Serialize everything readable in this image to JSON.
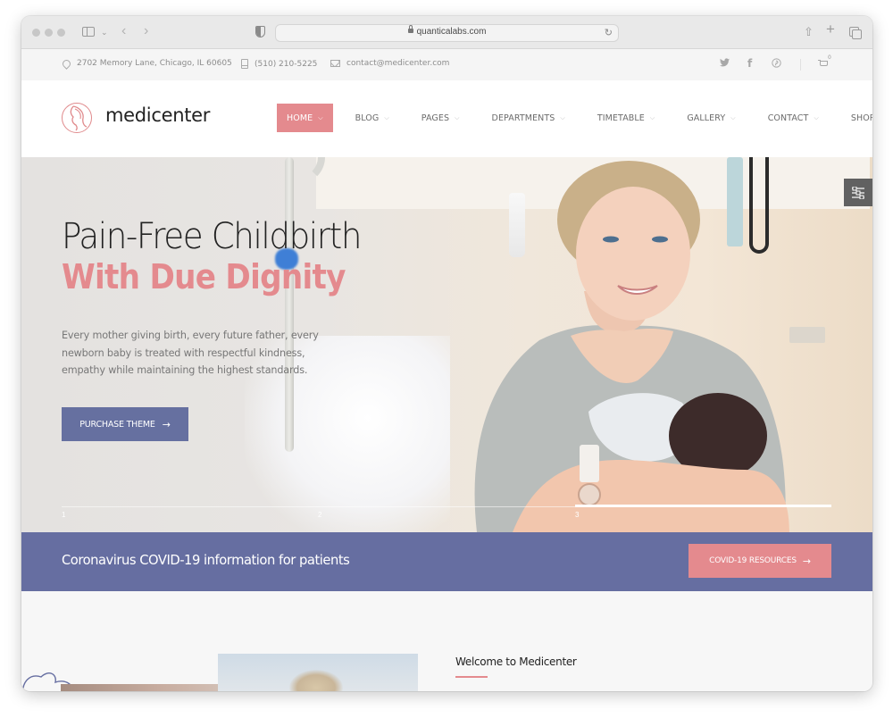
{
  "browser": {
    "url": "quanticalabs.com",
    "icons": [
      "sidebar-icon",
      "chevron-down-icon",
      "back-icon",
      "forward-icon",
      "privacy-shield-icon",
      "lock-icon",
      "reload-icon",
      "share-icon",
      "new-tab-icon",
      "tab-overview-icon"
    ]
  },
  "topbar": {
    "address": "2702 Memory Lane, Chicago, IL 60605",
    "phone": "(510) 210-5225",
    "email": "contact@medicenter.com",
    "social": [
      "twitter",
      "facebook",
      "pinterest"
    ],
    "social_glyphs": [
      "𝕥",
      "f",
      "℗"
    ],
    "cart_count": "0"
  },
  "header": {
    "logo_text": "medicenter",
    "menu": [
      {
        "label": "HOME",
        "active": true
      },
      {
        "label": "BLOG",
        "active": false
      },
      {
        "label": "PAGES",
        "active": false
      },
      {
        "label": "DEPARTMENTS",
        "active": false
      },
      {
        "label": "TIMETABLE",
        "active": false
      },
      {
        "label": "GALLERY",
        "active": false
      },
      {
        "label": "CONTACT",
        "active": false
      },
      {
        "label": "SHOP",
        "active": false
      }
    ],
    "chevron": "⌵"
  },
  "hero": {
    "title_line1": "Pain-Free Childbirth",
    "title_line2": "With Due Dignity",
    "description": "Every mother giving birth, every future father, every newborn baby is treated with respectful kindness, empathy while maintaining the highest standards.",
    "button_label": "PURCHASE THEME",
    "arrow": "→",
    "slides": [
      "1",
      "2",
      "3"
    ],
    "active_slide": 3,
    "slide_progress_fraction": 1.0
  },
  "covid": {
    "text": "Coronavirus COVID-19 information for patients",
    "button_label": "COVID-19 RESOURCES",
    "arrow": "→"
  },
  "welcome": {
    "title": "Welcome to Medicenter"
  },
  "colors": {
    "accent_pink": "#e48a8e",
    "accent_purple": "#666ea1",
    "settings_tab": "#616161"
  }
}
